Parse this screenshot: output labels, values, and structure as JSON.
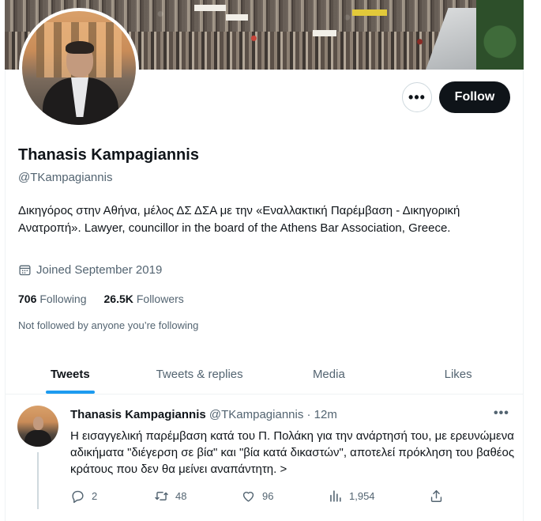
{
  "profile": {
    "name": "Thanasis Kampagiannis",
    "handle": "@TKampagiannis",
    "bio": "Δικηγόρος στην Αθήνα, μέλος ΔΣ ΔΣΑ με την «Εναλλακτική Παρέμβαση - Δικηγορική Ανατροπή». Lawyer, councillor in the board of the Athens Bar Association, Greece.",
    "joined": "Joined September 2019",
    "following_count": "706",
    "following_label": "Following",
    "followers_count": "26.5K",
    "followers_label": "Followers",
    "not_followed": "Not followed by anyone you’re following"
  },
  "buttons": {
    "more": "•••",
    "follow": "Follow"
  },
  "tabs": [
    {
      "label": "Tweets",
      "active": true
    },
    {
      "label": "Tweets & replies",
      "active": false
    },
    {
      "label": "Media",
      "active": false
    },
    {
      "label": "Likes",
      "active": false
    }
  ],
  "tweet": {
    "name": "Thanasis Kampagiannis",
    "meta": "@TKampagiannis · 12m",
    "more": "•••",
    "text": "Η εισαγγελική παρέμβαση κατά του Π. Πολάκη για την ανάρτησή του, με ερευνώμενα αδικήματα \"διέγερση σε βία\" και \"βία κατά δικαστών\", αποτελεί πρόκληση του βαθέος κράτους που δεν θα μείνει αναπάντητη. >",
    "replies": "2",
    "retweets": "48",
    "likes": "96",
    "views": "1,954"
  },
  "colors": {
    "accent": "#1d9bf0",
    "follow_bg": "#0f1419",
    "secondary_text": "#536471"
  },
  "icons": [
    "calendar-icon",
    "reply-icon",
    "retweet-icon",
    "like-icon",
    "views-icon",
    "share-icon",
    "more-icon"
  ]
}
